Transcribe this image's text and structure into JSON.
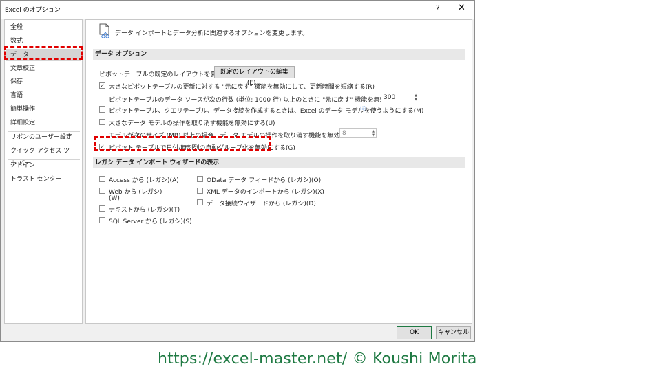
{
  "window": {
    "title": "Excel のオプション",
    "help": "?",
    "close": "✕"
  },
  "sidebar": {
    "items": [
      {
        "label": "全般"
      },
      {
        "label": "数式"
      },
      {
        "label": "データ",
        "selected": true
      },
      {
        "label": "文章校正"
      },
      {
        "label": "保存"
      },
      {
        "label": "言語"
      },
      {
        "label": "簡単操作"
      },
      {
        "label": "詳細設定"
      },
      {
        "label": "リボンのユーザー設定"
      },
      {
        "label": "クイック アクセス ツール バー"
      },
      {
        "label": "アドイン"
      },
      {
        "label": "トラスト センター"
      }
    ]
  },
  "main": {
    "header_text": "データ インポートとデータ分析に関連するオプションを変更します。",
    "data_options": {
      "title": "データ オプション",
      "pivot_layout_label": "ピボットテーブルの既定のレイアウトを変更する:",
      "pivot_layout_button": "既定のレイアウトの編集(E)...",
      "disable_undo_refresh": {
        "label": "大きなピボットテーブルの更新に対する \"元に戻す\" 機能を無効にして、更新時間を短縮する(R)",
        "checked": true
      },
      "undo_rows_label": "ピボットテーブルのデータ ソースが次の行数 (単位: 1000 行) 以上のときに \"元に戻す\" 機能を無効にする(N):",
      "undo_rows_value": "300",
      "prefer_data_model": {
        "label": "ピボットテーブル、クエリテーブル、データ接続を作成するときは、Excel のデータ モデルを使うようにする(M)",
        "checked": false
      },
      "info_icon": "ⓘ",
      "disable_undo_model": {
        "label": "大きなデータ モデルの操作を取り消す機能を無効にする(U)",
        "checked": false
      },
      "model_size_label": "モデルが次のサイズ (MB) 以上の場合、データ モデルの操作を取り消す機能を無効にする(L):",
      "model_size_value": "8",
      "disable_autogroup": {
        "label": "ピボット テーブルで日付/時刻列の自動グループ化を無効にする(G)",
        "checked": true
      }
    },
    "legacy": {
      "title": "レガシ データ インポート ウィザードの表示",
      "col1": [
        {
          "label": "Access から (レガシ)(A)"
        },
        {
          "label": "Web から (レガシ)",
          "label2": "(W)"
        },
        {
          "label": "テキストから (レガシ)(T)"
        },
        {
          "label": "SQL Server から (レガシ)(S)"
        }
      ],
      "col2": [
        {
          "label": "OData データ フィードから (レガシ)(O)"
        },
        {
          "label": "XML データのインポートから (レガシ)(X)"
        },
        {
          "label": "データ接続ウィザードから (レガシ)(D)"
        }
      ]
    }
  },
  "footer": {
    "ok": "OK",
    "cancel": "キャンセル",
    "credit": "https://excel-master.net/  © Koushi Morita"
  },
  "colors": {
    "highlight": "#e00000",
    "credit": "#1f7a43"
  }
}
